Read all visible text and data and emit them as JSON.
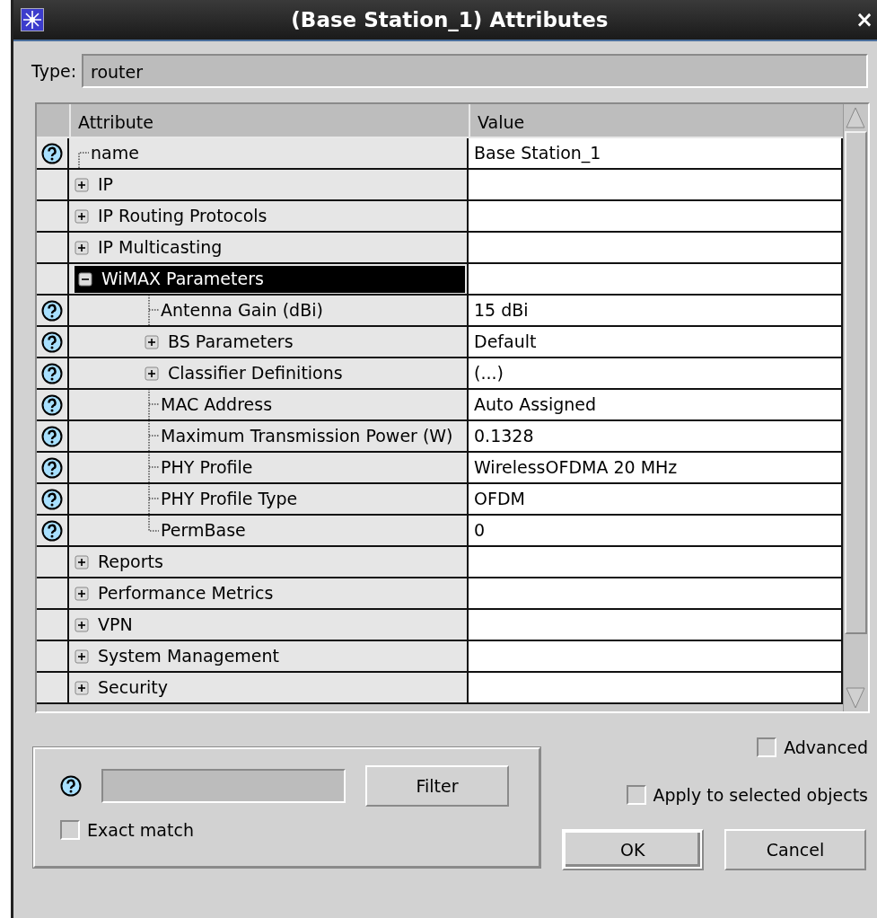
{
  "window": {
    "title": "(Base Station_1) Attributes",
    "close": "×"
  },
  "type_field": {
    "label": "Type:",
    "value": "router"
  },
  "table": {
    "columns": [
      "Attribute",
      "Value"
    ],
    "rows": [
      {
        "attribute": "name",
        "value": "Base Station_1",
        "help": true,
        "kind": "leaf",
        "selected": false
      },
      {
        "attribute": "IP",
        "help": false,
        "kind": "group",
        "expanded": false,
        "selected": false
      },
      {
        "attribute": "IP Routing Protocols",
        "help": false,
        "kind": "group",
        "expanded": false,
        "selected": false
      },
      {
        "attribute": "IP Multicasting",
        "help": false,
        "kind": "group",
        "expanded": false,
        "selected": false
      },
      {
        "attribute": "WiMAX Parameters",
        "help": false,
        "kind": "group",
        "expanded": true,
        "selected": true,
        "children": [
          {
            "attribute": "Antenna Gain (dBi)",
            "value": "15 dBi",
            "help": true,
            "kind": "leaf",
            "selected": false
          },
          {
            "attribute": "BS Parameters",
            "value": "Default",
            "help": true,
            "kind": "group",
            "expanded": false,
            "selected": false
          },
          {
            "attribute": "Classifier Definitions",
            "value": "(...)",
            "help": true,
            "kind": "group",
            "expanded": false,
            "selected": false
          },
          {
            "attribute": "MAC Address",
            "value": "Auto Assigned",
            "help": true,
            "kind": "leaf",
            "selected": false
          },
          {
            "attribute": "Maximum Transmission Power (W)",
            "value": "0.1328",
            "help": true,
            "kind": "leaf",
            "selected": false
          },
          {
            "attribute": "PHY Profile",
            "value": "WirelessOFDMA 20 MHz",
            "help": true,
            "kind": "leaf",
            "selected": false
          },
          {
            "attribute": "PHY Profile Type",
            "value": "OFDM",
            "help": true,
            "kind": "leaf",
            "selected": false
          },
          {
            "attribute": "PermBase",
            "value": "0",
            "help": true,
            "kind": "leaf",
            "selected": false
          }
        ]
      },
      {
        "attribute": "Reports",
        "help": false,
        "kind": "group",
        "expanded": false,
        "selected": false
      },
      {
        "attribute": "Performance Metrics",
        "help": false,
        "kind": "group",
        "expanded": false,
        "selected": false
      },
      {
        "attribute": "VPN",
        "help": false,
        "kind": "group",
        "expanded": false,
        "selected": false
      },
      {
        "attribute": "System Management",
        "help": false,
        "kind": "group",
        "expanded": false,
        "selected": false
      },
      {
        "attribute": "Security",
        "help": false,
        "kind": "group",
        "expanded": false,
        "selected": false
      }
    ]
  },
  "filter": {
    "button": {
      "label": "Filter"
    },
    "exact_match": {
      "label": "Exact match",
      "checked": false
    }
  },
  "options": [
    {
      "label": "Advanced",
      "checked": false
    },
    {
      "label": "Apply to selected objects",
      "checked": false
    }
  ],
  "buttons": [
    {
      "label": "OK",
      "default": true
    },
    {
      "label": "Cancel",
      "default": false
    }
  ]
}
